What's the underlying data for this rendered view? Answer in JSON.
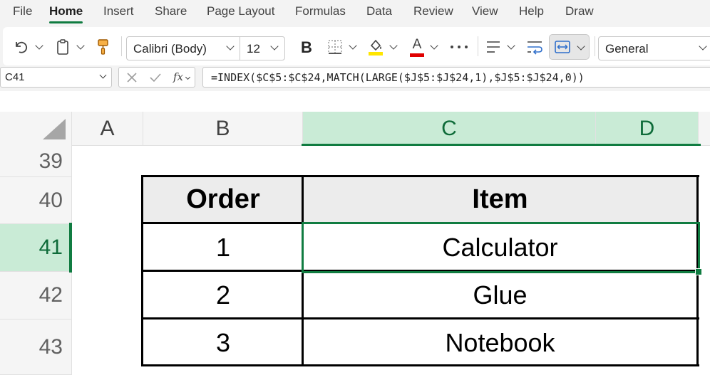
{
  "menu": {
    "items": [
      "File",
      "Home",
      "Insert",
      "Share",
      "Page Layout",
      "Formulas",
      "Data",
      "Review",
      "View",
      "Help",
      "Draw"
    ],
    "active": "Home"
  },
  "toolbar": {
    "font_name": "Calibri (Body)",
    "font_size": "12",
    "bold_label": "B",
    "font_color_label": "A",
    "number_format": "General",
    "fill_color": "#ffe600",
    "font_color": "#e00000",
    "icons": [
      "undo-icon",
      "clipboard-icon",
      "format-painter-icon",
      "borders-icon",
      "fill-color-icon",
      "font-color-icon",
      "more-icon",
      "align-icon",
      "wrap-text-icon",
      "merge-icon"
    ]
  },
  "formula_bar": {
    "name_box": "C41",
    "fx_label": "fx",
    "formula": "=INDEX($C$5:$C$24,MATCH(LARGE($J$5:$J$24,1),$J$5:$J$24,0))"
  },
  "grid": {
    "columns": [
      "A",
      "B",
      "C",
      "D"
    ],
    "selected_column": "C",
    "rows": [
      "39",
      "40",
      "41",
      "42",
      "43"
    ],
    "selected_row": "41"
  },
  "table": {
    "headers": [
      "Order",
      "Item"
    ],
    "rows": [
      [
        "1",
        "Calculator"
      ],
      [
        "2",
        "Glue"
      ],
      [
        "3",
        "Notebook"
      ]
    ]
  },
  "colors": {
    "accent": "#107c41",
    "selection_fill": "#c9ebd6"
  }
}
